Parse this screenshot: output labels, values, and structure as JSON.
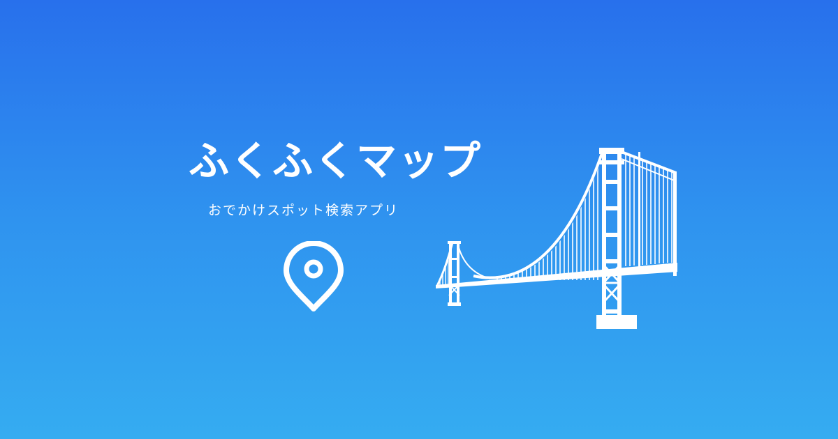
{
  "banner": {
    "title": "ふくふくマップ",
    "subtitle": "おでかけスポット検索アプリ",
    "icons": {
      "location": "map-pin-icon",
      "illustration": "suspension-bridge-icon"
    },
    "colors": {
      "gradient_top": "#2870ec",
      "gradient_bottom": "#35acf1",
      "foreground": "#ffffff"
    }
  }
}
